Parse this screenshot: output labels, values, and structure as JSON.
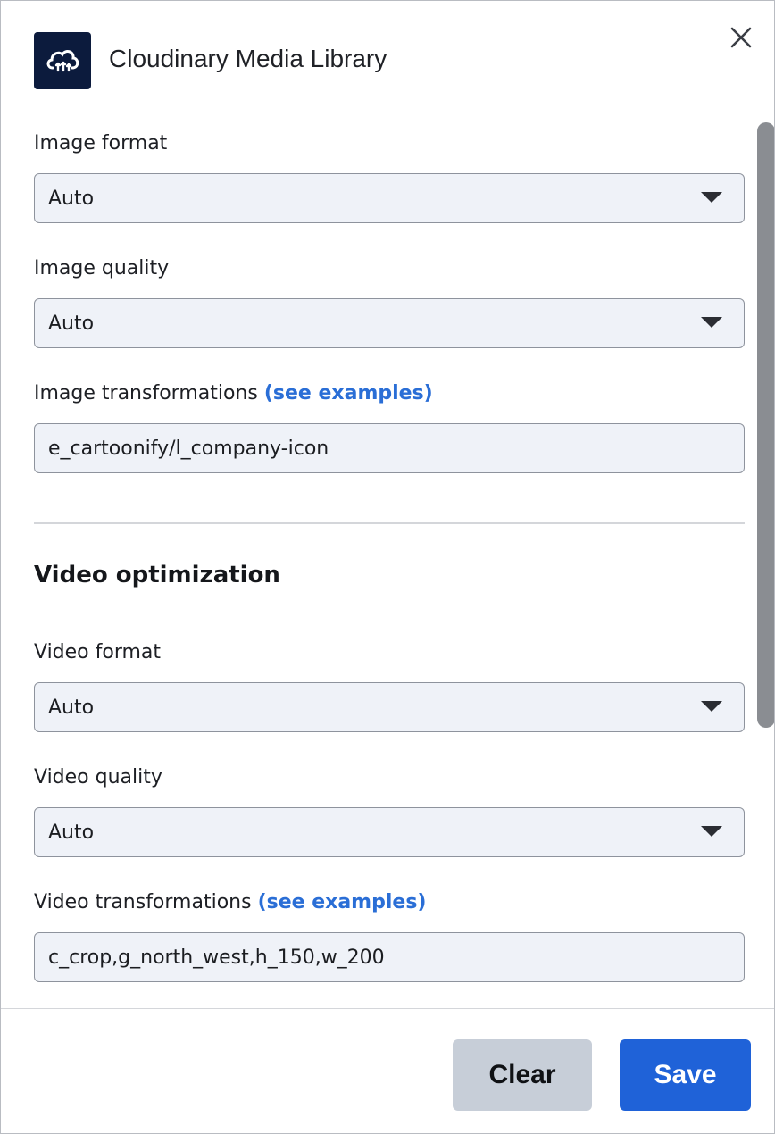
{
  "header": {
    "title": "Cloudinary Media Library",
    "logo_icon": "cloudinary-cloud-icon",
    "close_icon": "close-icon"
  },
  "image_settings": {
    "format_label": "Image format",
    "format_value": "Auto",
    "quality_label": "Image quality",
    "quality_value": "Auto",
    "transformations_label": "Image transformations",
    "transformations_link": "(see examples)",
    "transformations_value": "e_cartoonify/l_company-icon"
  },
  "video_section": {
    "title": "Video optimization",
    "format_label": "Video format",
    "format_value": "Auto",
    "quality_label": "Video quality",
    "quality_value": "Auto",
    "transformations_label": "Video transformations",
    "transformations_link": "(see examples)",
    "transformations_value": "c_crop,g_north_west,h_150,w_200"
  },
  "footer": {
    "clear_label": "Clear",
    "save_label": "Save"
  },
  "colors": {
    "primary": "#1f62d8",
    "link": "#2a6ed6",
    "logo_bg": "#0c1b3d",
    "input_bg": "#eff2f8"
  }
}
